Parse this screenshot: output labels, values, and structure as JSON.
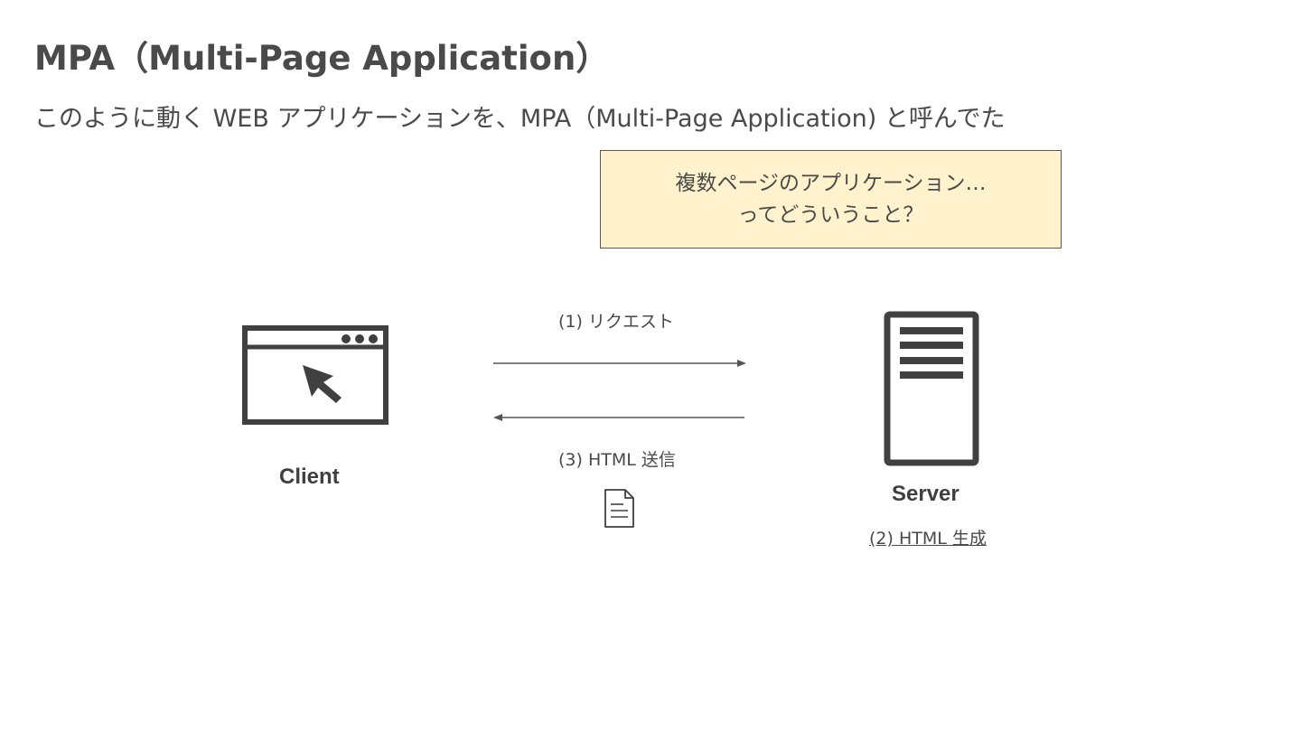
{
  "slide": {
    "title": "MPA（Multi-Page Application）",
    "subtitle": "このように動く WEB アプリケーションを、MPA（Multi-Page Application) と呼んでた"
  },
  "note": {
    "line1": "複数ページのアプリケーション…",
    "line2": "ってどういうこと？"
  },
  "diagram": {
    "client_label": "Client",
    "server_label": "Server",
    "request_label": "(1) リクエスト",
    "response_label": "(3) HTML 送信",
    "generate_label": "(2) HTML 生成"
  },
  "colors": {
    "note_background": "#fff2cc",
    "icon": "#404040",
    "text": "#4a4a4a"
  }
}
